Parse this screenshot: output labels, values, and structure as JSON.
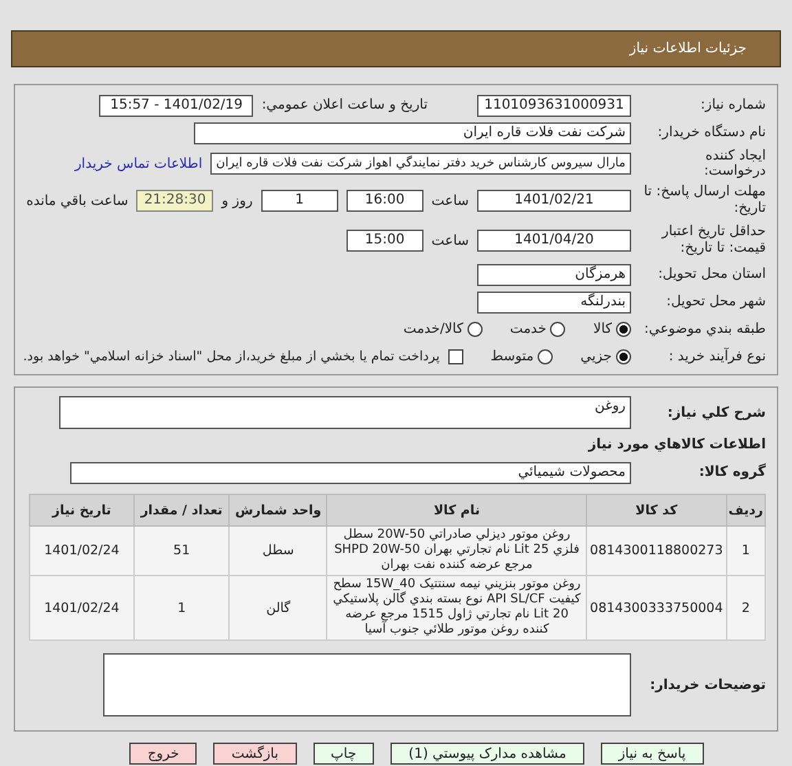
{
  "header": {
    "title": "جزئيات اطلاعات نياز"
  },
  "need_number": {
    "label": "شماره نياز:",
    "value": "1101093631000931"
  },
  "announce": {
    "label": "تاريخ و ساعت اعلان عمومي:",
    "value": "1401/02/19 - 15:57"
  },
  "buyer_org": {
    "label": "نام دستگاه خريدار:",
    "value": "شرکت نفت فلات قاره ايران"
  },
  "requester": {
    "label": "ايجاد کننده درخواست:",
    "value": "مارال سيروس کارشناس خريد دفتر نمايندگي اهواز شرکت نفت فلات قاره ايران",
    "link": "اطلاعات تماس خريدار"
  },
  "deadline": {
    "label": "مهلت ارسال پاسخ: تا تاريخ:",
    "date": "1401/02/21",
    "time_label": "ساعت",
    "time": "16:00",
    "days": "1",
    "days_label": "روز و",
    "remaining": "21:28:30",
    "remaining_label": "ساعت باقي مانده"
  },
  "validity": {
    "label": "حداقل تاريخ اعتبار قيمت: تا تاريخ:",
    "date": "1401/04/20",
    "time_label": "ساعت",
    "time": "15:00"
  },
  "province": {
    "label": "استان محل تحويل:",
    "value": "هرمزگان"
  },
  "city": {
    "label": "شهر محل تحويل:",
    "value": "بندرلنگه"
  },
  "category": {
    "label": "طبقه بندي موضوعي:",
    "options": [
      {
        "label": "کالا",
        "selected": true
      },
      {
        "label": "خدمت",
        "selected": false
      },
      {
        "label": "کالا/خدمت",
        "selected": false
      }
    ]
  },
  "process": {
    "label": "نوع فرآيند خريد :",
    "options": [
      {
        "label": "جزيي",
        "selected": true
      },
      {
        "label": "متوسط",
        "selected": false
      }
    ],
    "treasury": {
      "checked": false,
      "label": "پرداخت تمام يا بخشي از مبلغ خريد،از محل \"اسناد خزانه اسلامي\" خواهد بود."
    }
  },
  "description": {
    "label": "شرح کلي نياز:",
    "value": "روغن"
  },
  "goods_heading": "اطلاعات کالاهاي مورد نياز",
  "goods_group": {
    "label": "گروه کالا:",
    "value": "محصولات شيميائي"
  },
  "table": {
    "columns": [
      "رديف",
      "کد کالا",
      "نام کالا",
      "واحد شمارش",
      "تعداد / مقدار",
      "تاريخ نياز"
    ],
    "rows": [
      [
        "1",
        "0814300118800273",
        "روغن موتور ديزلي صادراتي 20W-50 سطل فلزي 25 Lit نام تجارتي بهران SHPD 20W-50 مرجع عرضه کننده نفت بهران",
        "سطل",
        "51",
        "1401/02/24"
      ],
      [
        "2",
        "0814300333750004",
        "روغن موتور بنزيني نيمه سنتتيک 15W_40 سطح کيفيت API SL/CF نوع بسته بندي گالن پلاستيکي 20 Lit نام تجارتي ژاول 1515 مرجع عرضه کننده روغن موتور طلائي جنوب آسيا",
        "گالن",
        "1",
        "1401/02/24"
      ]
    ]
  },
  "buyer_notes": {
    "label": "توضيحات خريدار:"
  },
  "buttons": [
    {
      "label": "پاسخ به نياز",
      "kind": "action"
    },
    {
      "label": "مشاهده مدارک پيوستي (1)",
      "kind": "action"
    },
    {
      "label": "چاپ",
      "kind": "action"
    },
    {
      "label": "بازگشت",
      "kind": "exit"
    },
    {
      "label": "خروج",
      "kind": "exit"
    }
  ]
}
